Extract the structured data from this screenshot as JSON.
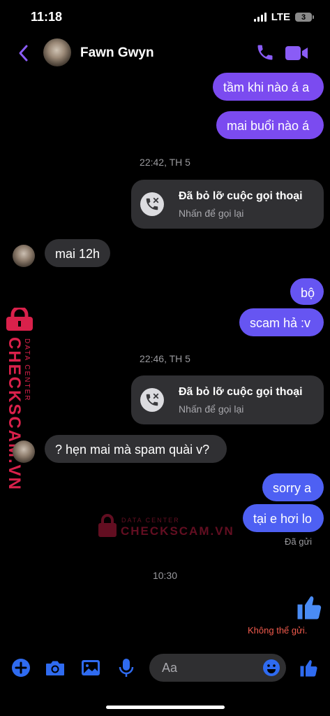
{
  "status_bar": {
    "time": "11:18",
    "network": "LTE",
    "battery": "3"
  },
  "header": {
    "contact_name": "Fawn Gwyn"
  },
  "colors": {
    "accent": "#7b4bf0",
    "outgoing_blue": "#4e60f3",
    "incoming_bg": "#303033",
    "error": "#f05a4c",
    "watermark": "#d9214b"
  },
  "messages": {
    "m1": "tầm khi nào á a",
    "m2": "mai buổi nào á",
    "time1": "22:42, TH 5",
    "call1": {
      "title": "Đã bỏ lỡ cuộc gọi thoại",
      "subtitle": "Nhấn để gọi lại"
    },
    "m3": "mai 12h",
    "m4": "bộ",
    "m5": "scam hả :v",
    "time2": "22:46, TH 5",
    "call2": {
      "title": "Đã bỏ lỡ cuộc gọi thoại",
      "subtitle": "Nhấn để gọi lại"
    },
    "m6": "? hẹn mai mà spam quài v?",
    "m7": "sorry a",
    "m8": "tại e hơi lo",
    "sent_status": "Đã gửi",
    "time3": "10:30",
    "failed_status": "Không thể gửi."
  },
  "watermark": {
    "brand": "CHECKSCAM.VN",
    "subtitle": "DATA CENTER"
  },
  "composer": {
    "placeholder": "Aa"
  },
  "icons": [
    "back-chevron-icon",
    "phone-icon",
    "video-camera-icon",
    "missed-call-icon",
    "thumbs-up-icon",
    "plus-icon",
    "camera-icon",
    "image-icon",
    "microphone-icon",
    "emoji-icon",
    "lock-icon"
  ]
}
